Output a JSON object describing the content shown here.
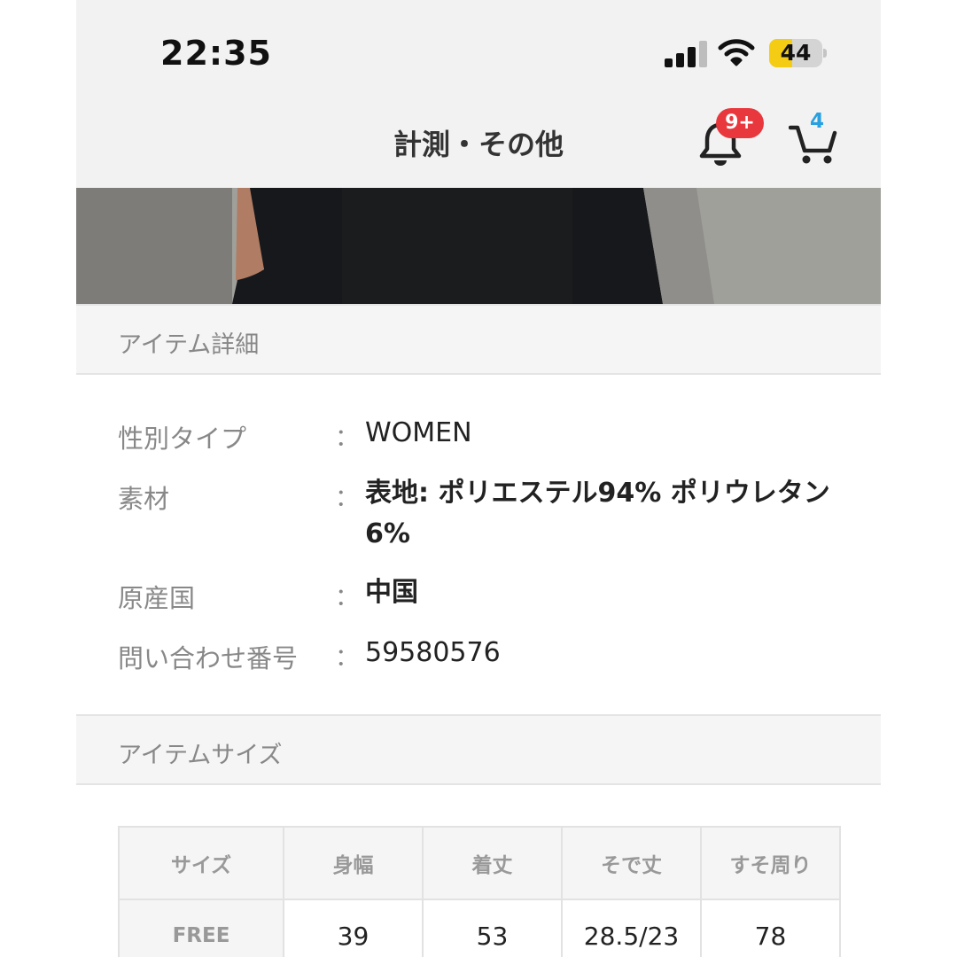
{
  "status_bar": {
    "time": "22:35",
    "battery_level": "44",
    "battery_fraction": 0.44,
    "battery_color": "#f5cc14"
  },
  "header": {
    "title": "計測・その他",
    "bell_icon": "bell-icon",
    "notification_badge": "9+",
    "notification_badge_color": "#e8383d",
    "cart_icon": "cart-icon",
    "cart_count": "4",
    "cart_count_color": "#29a0e0"
  },
  "item_details": {
    "section_title": "アイテム詳細",
    "colon": "：",
    "rows": [
      {
        "label": "性別タイプ",
        "value": "WOMEN"
      },
      {
        "label": "素材",
        "value": "表地: ポリエステル94% ポリウレタン6%"
      },
      {
        "label": "原産国",
        "value": "中国"
      },
      {
        "label": "問い合わせ番号",
        "value": "59580576"
      }
    ]
  },
  "item_size": {
    "section_title": "アイテムサイズ",
    "headers": [
      "サイズ",
      "身幅",
      "着丈",
      "そで丈",
      "すそ周り"
    ],
    "rows": [
      [
        "FREE",
        "39",
        "53",
        "28.5/23",
        "78"
      ]
    ]
  }
}
